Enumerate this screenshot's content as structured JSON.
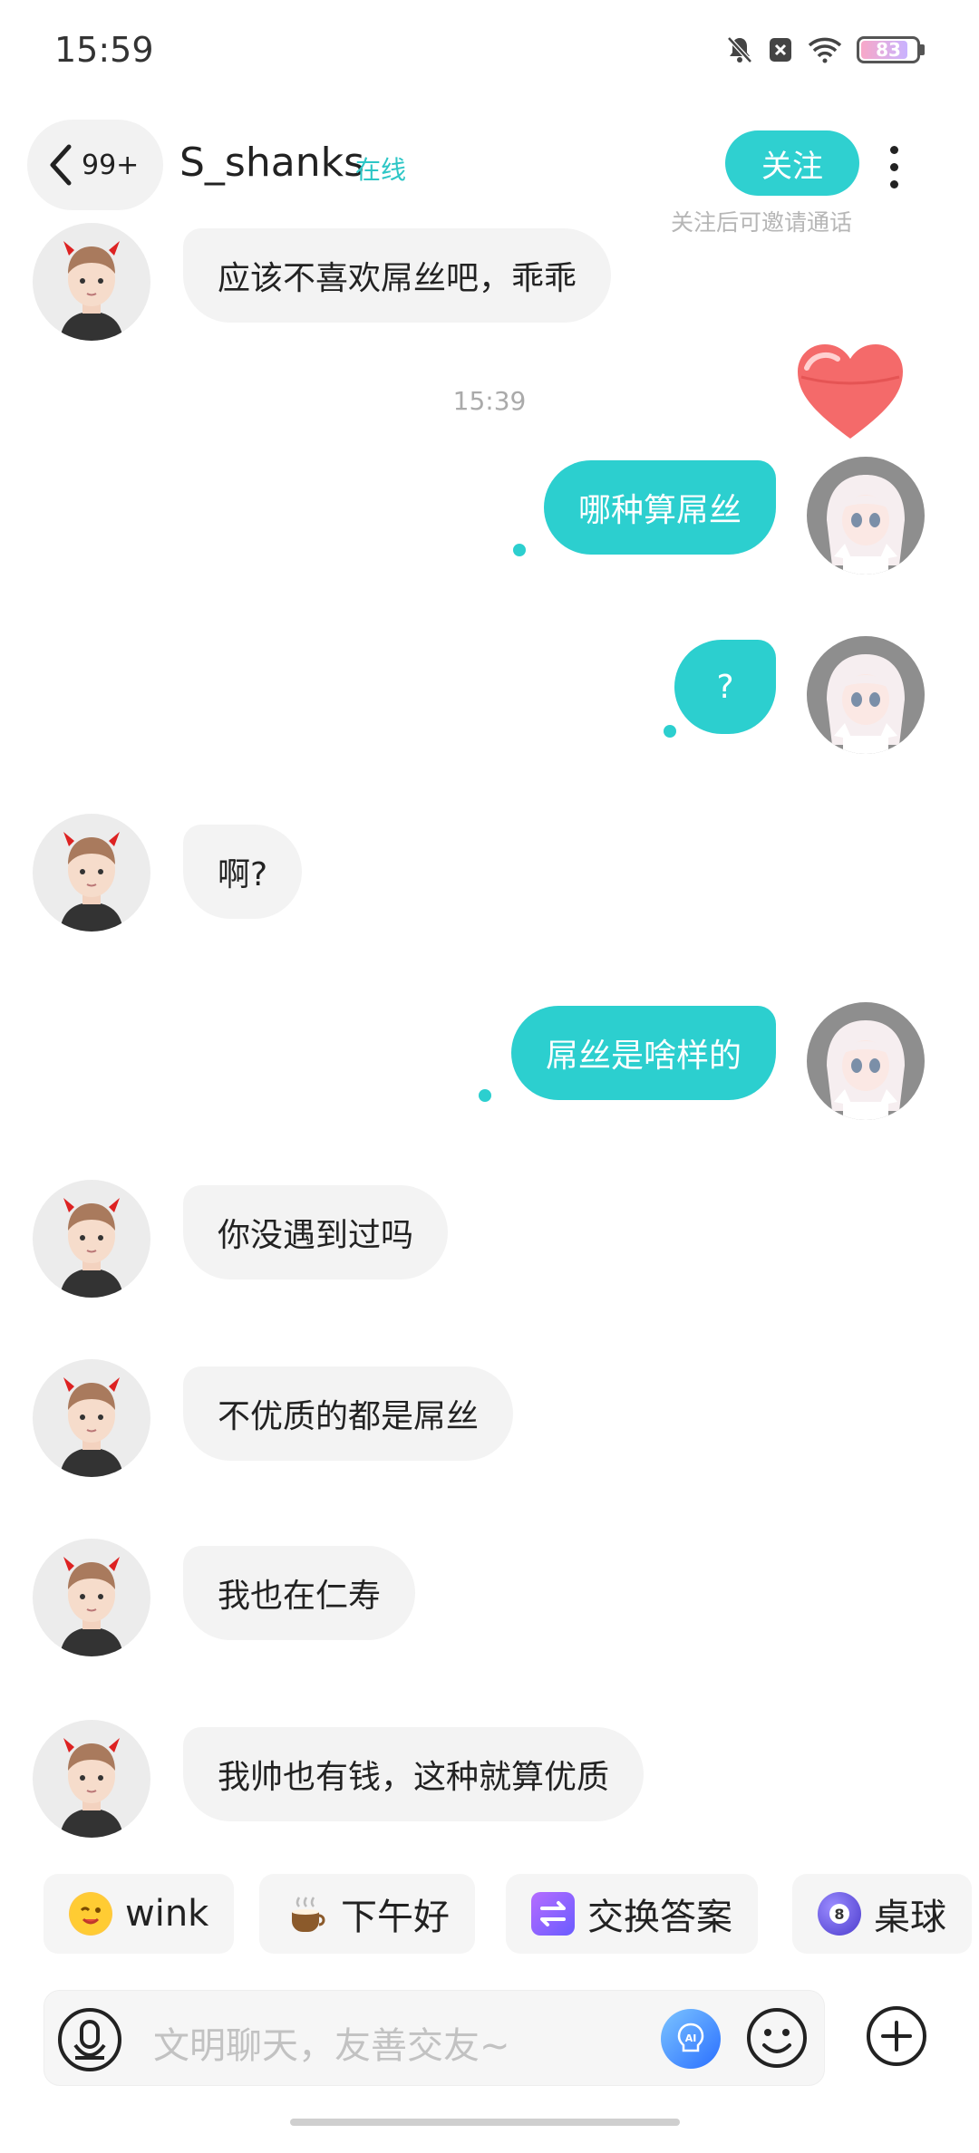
{
  "status_bar": {
    "time": "15:59",
    "battery": "83"
  },
  "header": {
    "back_count": "99+",
    "contact_name": "S_shanks",
    "online_status": "在线",
    "follow_label": "关注",
    "follow_hint": "关注后可邀请通话"
  },
  "messages": [
    {
      "side": "left",
      "text": "应该不喜欢屌丝吧，乖乖"
    },
    {
      "side": "separator",
      "text": "15:39"
    },
    {
      "side": "right",
      "text": "哪种算屌丝"
    },
    {
      "side": "right",
      "text": "?"
    },
    {
      "side": "left",
      "text": "啊?"
    },
    {
      "side": "right",
      "text": "屌丝是啥样的"
    },
    {
      "side": "left",
      "text": "你没遇到过吗"
    },
    {
      "side": "left",
      "text": "不优质的都是屌丝"
    },
    {
      "side": "left",
      "text": "我也在仁寿"
    },
    {
      "side": "left",
      "text": "我帅也有钱，这种就算优质"
    }
  ],
  "quick_replies": [
    {
      "label": "wink",
      "icon": "wink-emoji-icon"
    },
    {
      "label": "下午好",
      "icon": "coffee-icon"
    },
    {
      "label": "交换答案",
      "icon": "exchange-icon"
    },
    {
      "label": "桌球",
      "icon": "billiard-ball-icon"
    }
  ],
  "input": {
    "placeholder": "文明聊天，友善交友~"
  },
  "colors": {
    "accent": "#2ccfcf",
    "bubble_left": "#f3f3f3"
  }
}
